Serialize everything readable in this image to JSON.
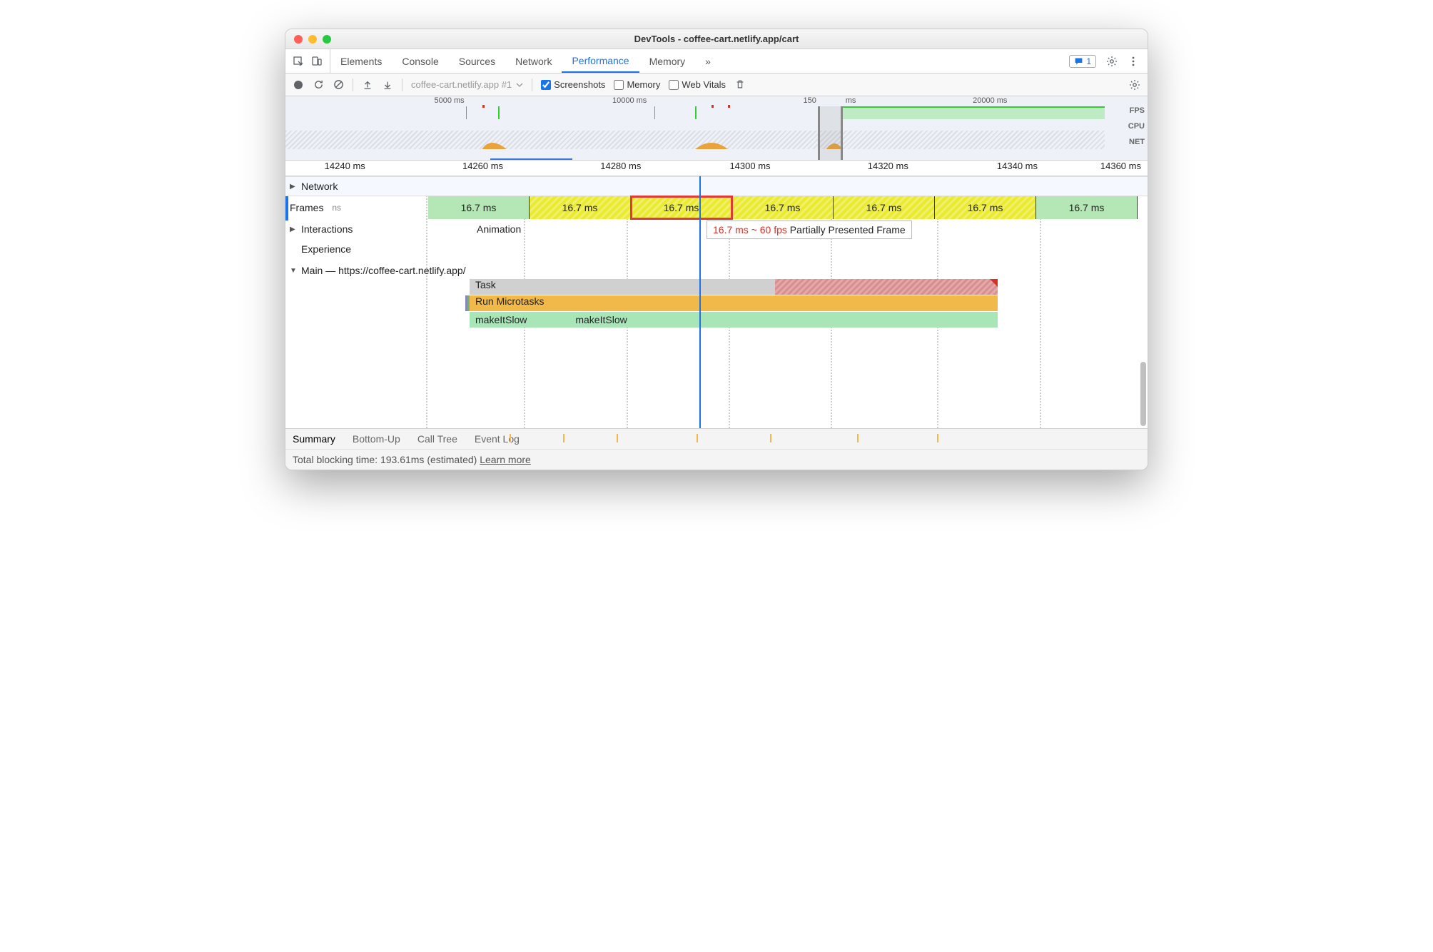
{
  "window": {
    "title": "DevTools - coffee-cart.netlify.app/cart"
  },
  "main_tabs": [
    "Elements",
    "Console",
    "Sources",
    "Network",
    "Performance",
    "Memory"
  ],
  "main_tab_active": 4,
  "issues_count": "1",
  "toolbar": {
    "recording_label": "coffee-cart.netlify.app #1",
    "screenshots": "Screenshots",
    "memory": "Memory",
    "webvitals": "Web Vitals"
  },
  "overview": {
    "ticks": [
      "5000 ms",
      "10000 ms",
      "150",
      "ms",
      "20000 ms"
    ],
    "labels": [
      "FPS",
      "CPU",
      "NET"
    ]
  },
  "ruler": [
    "14240 ms",
    "14260 ms",
    "14280 ms",
    "14300 ms",
    "14320 ms",
    "14340 ms",
    "14360 ms"
  ],
  "rows": {
    "network": "Network",
    "frames": "Frames",
    "ms_suffix": "ns",
    "interactions": "Interactions",
    "animation": "Animation",
    "experience": "Experience",
    "main": "Main — https://coffee-cart.netlify.app/"
  },
  "frame_values": [
    "16.7 ms",
    "16.7 ms",
    "16.7 ms",
    "16.7 ms",
    "16.7 ms",
    "16.7 ms",
    "16.7 ms"
  ],
  "tooltip": {
    "red": "16.7 ms ~ 60 fps",
    "rest": "Partially Presented Frame"
  },
  "flame": {
    "task": "Task",
    "micro": "Run Microtasks",
    "slow": "makeItSlow",
    "slow2": "makeItSlow"
  },
  "bottom_tabs": [
    "Summary",
    "Bottom-Up",
    "Call Tree",
    "Event Log"
  ],
  "status": {
    "prefix": "Total blocking time: 193.61ms (estimated)  ",
    "link": "Learn more"
  }
}
